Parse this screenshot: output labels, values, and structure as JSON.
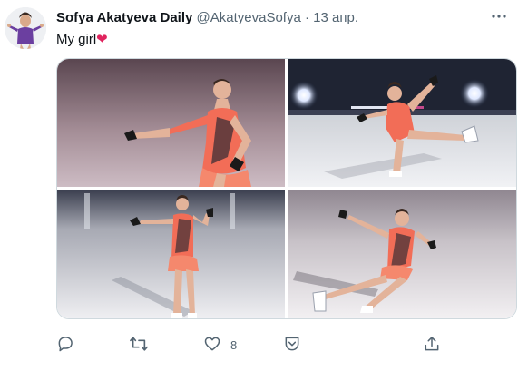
{
  "tweet": {
    "display_name": "Sofya Akatyeva Daily",
    "handle": "@AkatyevaSofya",
    "separator": "·",
    "date": "13 апр.",
    "text": "My girl",
    "emoji": "❤"
  },
  "actions": {
    "like_count": "8"
  },
  "icons": [
    "more-options-icon",
    "reply-icon",
    "retweet-icon",
    "like-icon",
    "share-icon",
    "upload-icon"
  ],
  "colors": {
    "text_primary": "#0f1419",
    "text_secondary": "#536471",
    "heart": "#e0245e",
    "costume": "#f26d57"
  }
}
